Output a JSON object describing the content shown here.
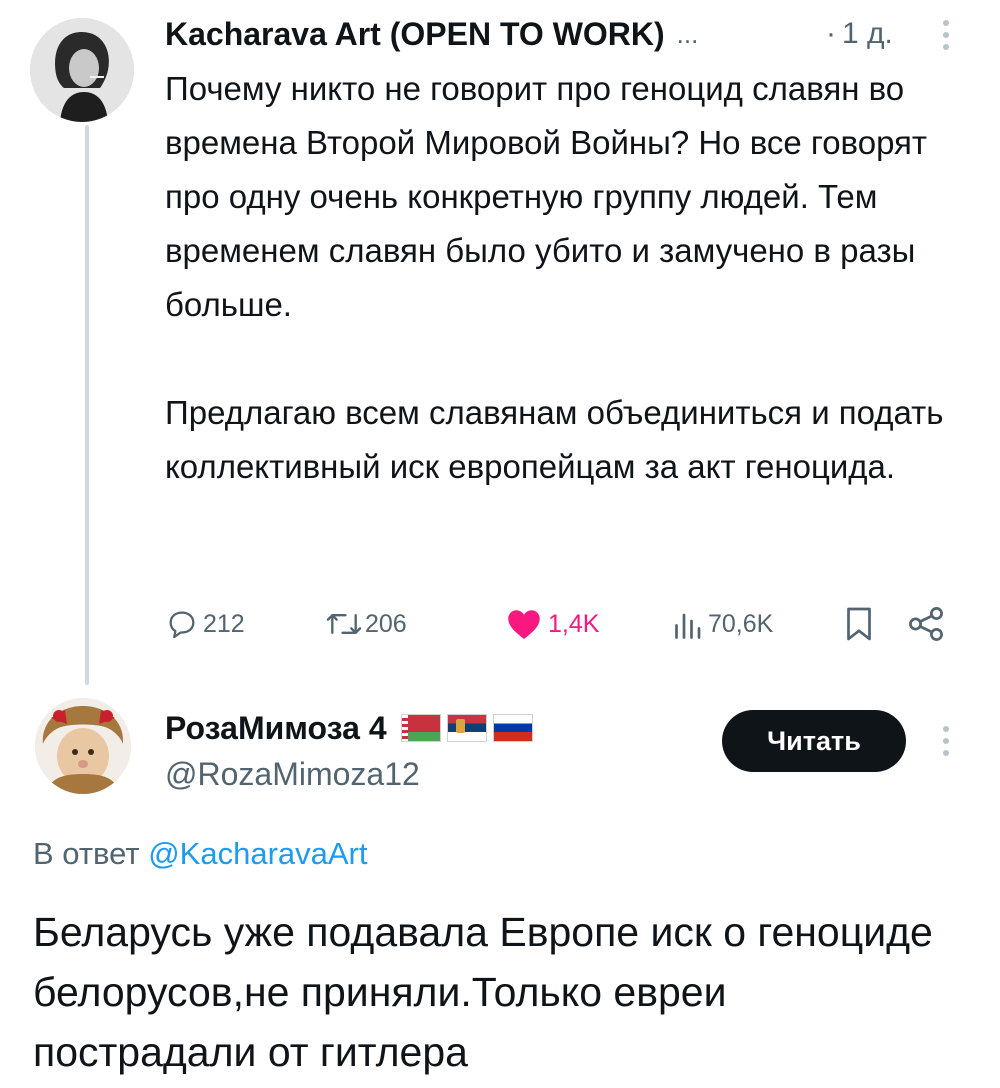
{
  "tweet": {
    "author_name": "Kacharava Art (OPEN TO WORK)",
    "ellipsis": "...",
    "separator": "·",
    "time": "1 д.",
    "paragraph1": "Почему никто не говорит про геноцид славян во времена Второй Мировой Войны? Но все говорят про одну очень конкретную группу людей. Тем временем славян было убито и замучено в разы больше.",
    "paragraph2": "Предлагаю всем славянам объединиться и подать коллективный иск европейцам за акт геноцида.",
    "stats": {
      "replies": "212",
      "reposts": "206",
      "likes": "1,4K",
      "views": "70,6K"
    }
  },
  "reply": {
    "author_name": "РозаМимоза 4",
    "flags": [
      "belarus-flag",
      "serbia-flag",
      "russia-flag"
    ],
    "handle": "@RozaMimoza12",
    "follow_label": "Читать",
    "in_reply_prefix": "В ответ",
    "in_reply_handle": "@KacharavaArt",
    "text": "Беларусь уже подавала Европе иск о геноциде белорусов,не приняли.Только евреи пострадали от гитлера"
  },
  "colors": {
    "text": "#0f1419",
    "muted": "#536471",
    "link": "#1d9bf0",
    "like": "#f91880",
    "thread_line": "#cfd9de",
    "button": "#0f1419"
  },
  "icons": [
    "reply-icon",
    "repost-icon",
    "heart-icon",
    "views-icon",
    "bookmark-icon",
    "share-icon",
    "more-icon"
  ]
}
